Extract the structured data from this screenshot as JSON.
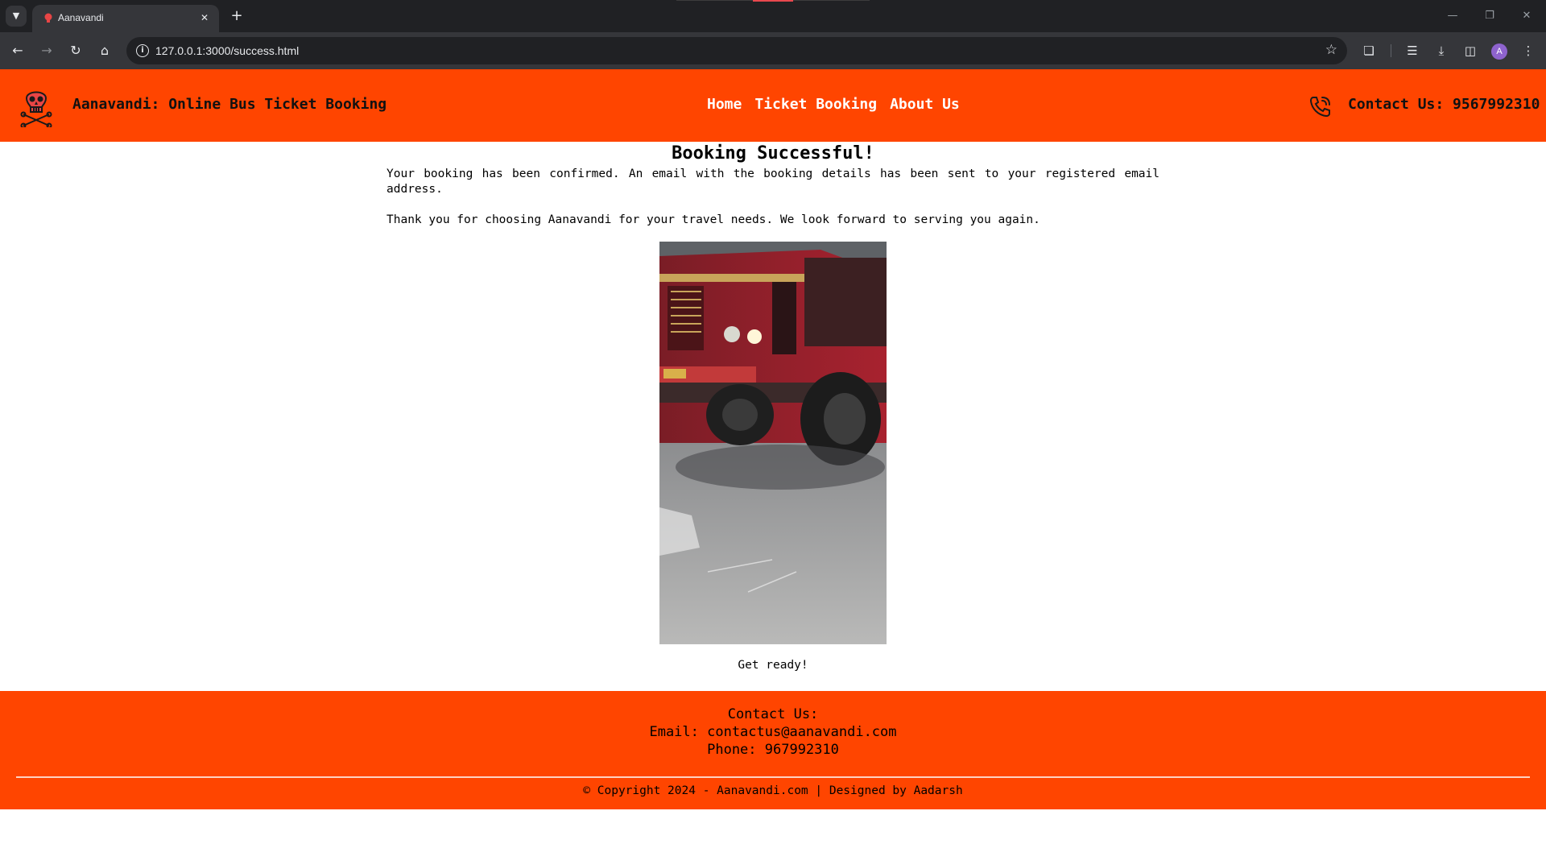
{
  "browser": {
    "tab_title": "Aanavandi",
    "url": "127.0.0.1:3000/success.html",
    "profile_initial": "A"
  },
  "header": {
    "title": "Aanavandi: Online Bus Ticket Booking",
    "nav": [
      "Home",
      "Ticket Booking",
      "About Us"
    ],
    "contact": "Contact Us: 9567992310"
  },
  "main": {
    "heading": "Booking Successful!",
    "paragraph1": "Your booking has been confirmed. An email with the booking details has been sent to your registered email address.",
    "paragraph2": "Thank you for choosing Aanavandi for your travel needs. We look forward to serving you again.",
    "caption": "Get ready!"
  },
  "footer": {
    "contact_heading": "Contact Us:",
    "email": "Email: contactus@aanavandi.com",
    "phone": "Phone: 967992310",
    "copyright": "© Copyright 2024 - Aanavandi.com | Designed by Aadarsh"
  },
  "colors": {
    "brand": "#ff4500",
    "chrome_dark": "#202124",
    "chrome_toolbar": "#35363a"
  },
  "icons": {
    "logo": "skull-crossbones-icon",
    "phone": "phone-icon"
  }
}
